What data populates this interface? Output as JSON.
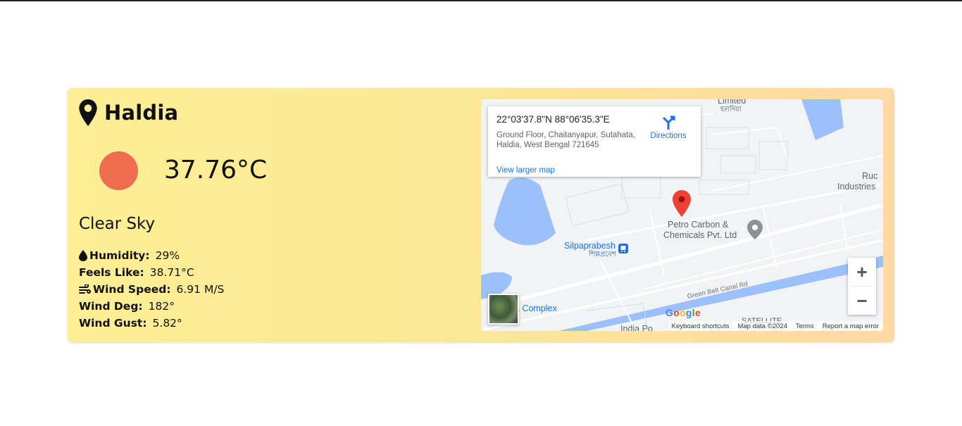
{
  "weather": {
    "city": "Haldia",
    "temperature": "37.76°C",
    "condition": "Clear Sky",
    "sun_color": "#ed6e4f",
    "stats": {
      "humidity": {
        "label": "Humidity:",
        "value": "29%",
        "icon": "water-drop-icon"
      },
      "feels_like": {
        "label": "Feels Like:",
        "value": "38.71°C"
      },
      "wind_speed": {
        "label": "Wind Speed:",
        "value": "6.91 M/S",
        "icon": "wind-icon"
      },
      "wind_deg": {
        "label": "Wind Deg:",
        "value": "182°"
      },
      "wind_gust": {
        "label": "Wind Gust:",
        "value": "5.82°"
      }
    }
  },
  "map": {
    "info": {
      "coordinates": "22°03'37.8\"N 88°06'35.3\"E",
      "address": "Ground Floor, Chaitanyapur, Sutahata, Haldia, West Bengal 721645",
      "directions_label": "Directions",
      "view_larger_label": "View larger map"
    },
    "labels": {
      "place_1": "Petro Carbon &",
      "place_1b": "Chemicals Pvt. Ltd",
      "station": "Silpaprabesh",
      "station_local": "শিল্পপ্রবেশ",
      "industries_1": "Ruc",
      "industries_2": "Industries",
      "limited_1": "Limited",
      "limited_2": "হলদিয়া",
      "road": "Green Belt Canal Rd",
      "complex": "a Complex",
      "india_po": "India Po",
      "satellite": "SATELLITE"
    },
    "zoom_in": "+",
    "zoom_out": "−",
    "logo": "Google",
    "footer": {
      "shortcuts": "Keyboard shortcuts",
      "map_data": "Map data ©2024",
      "terms": "Terms",
      "report": "Report a map error"
    },
    "colors": {
      "water": "#9cc0f9",
      "marker": "#ea4335",
      "link": "#1a73e8"
    }
  }
}
